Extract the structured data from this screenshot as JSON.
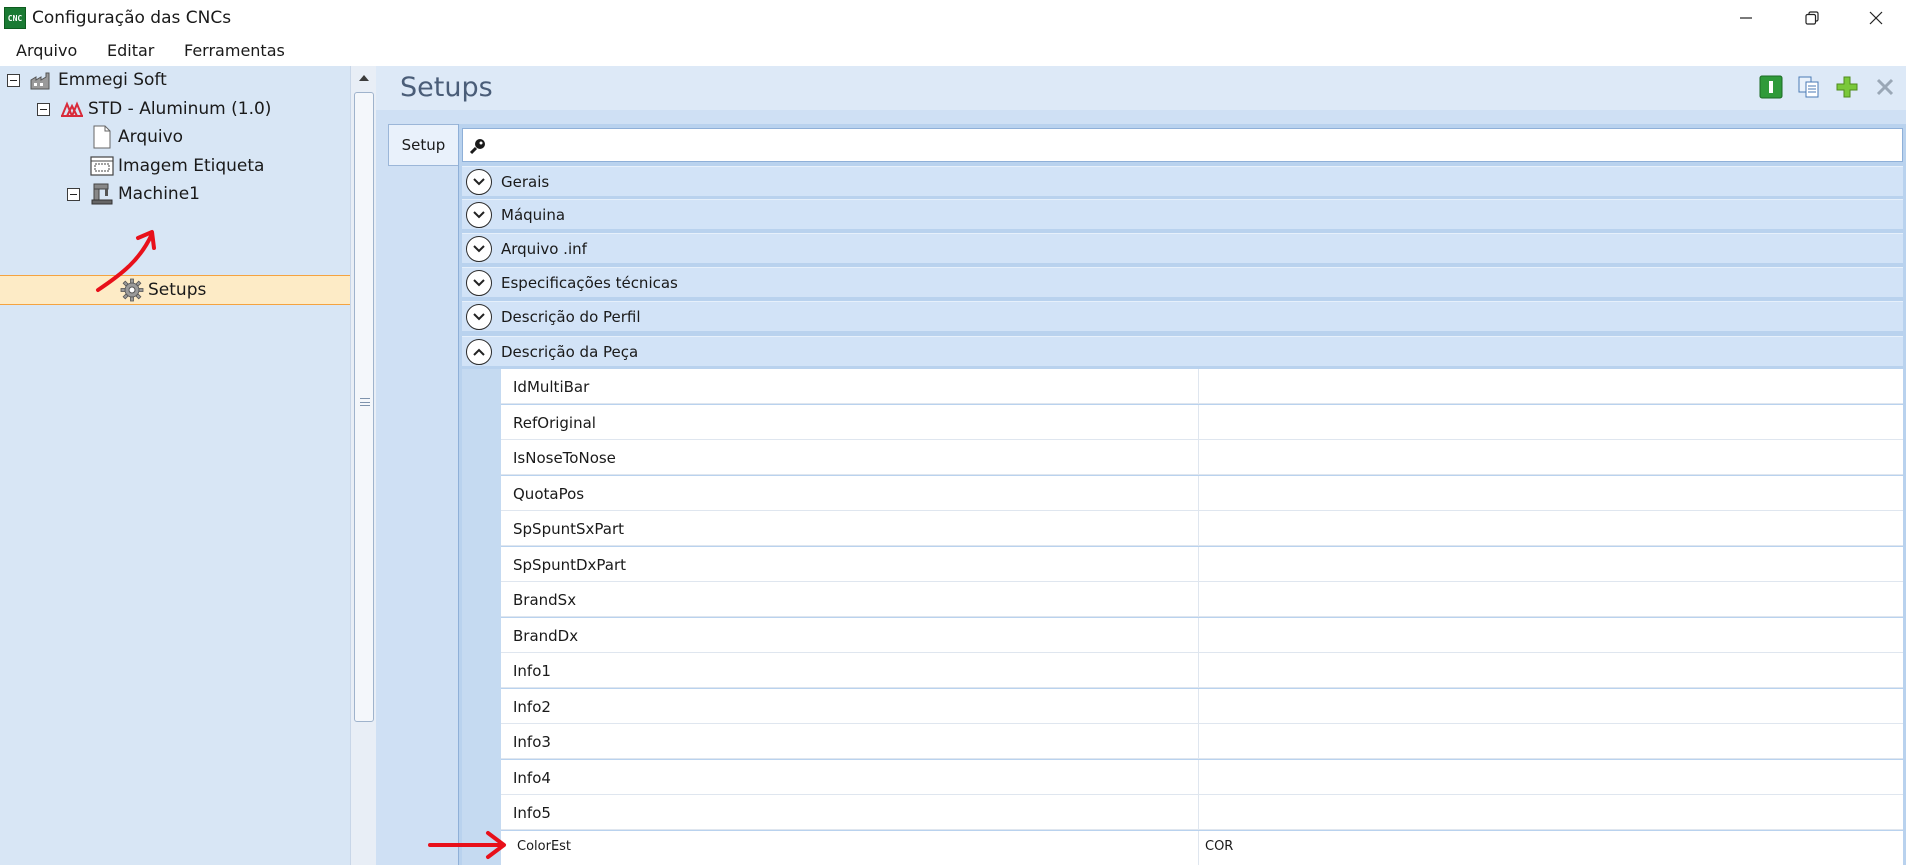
{
  "window": {
    "title": "Configuração das CNCs",
    "icon_text": "CNC",
    "controls": [
      "minimize-icon",
      "restore-icon",
      "close-icon"
    ]
  },
  "menu": {
    "items": [
      "Arquivo",
      "Editar",
      "Ferramentas"
    ]
  },
  "tree": {
    "items": [
      {
        "label": "Emmegi Soft",
        "icon": "factory-icon",
        "level": 0,
        "expanded": true
      },
      {
        "label": "STD - Aluminum (1.0)",
        "icon": "profile-icon",
        "level": 1,
        "expanded": true
      },
      {
        "label": "Arquivo",
        "icon": "document-icon",
        "level": 2
      },
      {
        "label": "Imagem Etiqueta",
        "icon": "label-image-icon",
        "level": 2
      },
      {
        "label": "Machine1",
        "icon": "machine-icon",
        "level": 2,
        "expanded": true
      },
      {
        "label": "Setups",
        "icon": "gear-icon",
        "level": 3,
        "selected": true
      }
    ]
  },
  "content": {
    "title": "Setups",
    "toolbar": [
      "info-icon",
      "copy-icon",
      "add-icon",
      "delete-icon"
    ],
    "tab": "Setup",
    "search_placeholder": "",
    "groups": [
      {
        "label": "Gerais",
        "expanded": false
      },
      {
        "label": "Máquina",
        "expanded": false
      },
      {
        "label": "Arquivo .inf",
        "expanded": false
      },
      {
        "label": "Especificações técnicas",
        "expanded": false
      },
      {
        "label": "Descrição do Perfil",
        "expanded": false
      },
      {
        "label": "Descrição da Peça",
        "expanded": true
      }
    ],
    "properties": [
      {
        "name": "IdMultiBar",
        "value": ""
      },
      {
        "name": "RefOriginal",
        "value": ""
      },
      {
        "name": "IsNoseToNose",
        "value": ""
      },
      {
        "name": "QuotaPos",
        "value": ""
      },
      {
        "name": "SpSpuntSxPart",
        "value": ""
      },
      {
        "name": "SpSpuntDxPart",
        "value": ""
      },
      {
        "name": "BrandSx",
        "value": ""
      },
      {
        "name": "BrandDx",
        "value": ""
      },
      {
        "name": "Info1",
        "value": ""
      },
      {
        "name": "Info2",
        "value": ""
      },
      {
        "name": "Info3",
        "value": ""
      },
      {
        "name": "Info4",
        "value": ""
      },
      {
        "name": "Info5",
        "value": ""
      },
      {
        "name": "ColorEst",
        "value": "COR"
      }
    ]
  },
  "colors": {
    "panel": "#d8e6f5",
    "selection": "#fdebc6",
    "selection_border": "#f4a340",
    "annotation": "#e8101a"
  }
}
